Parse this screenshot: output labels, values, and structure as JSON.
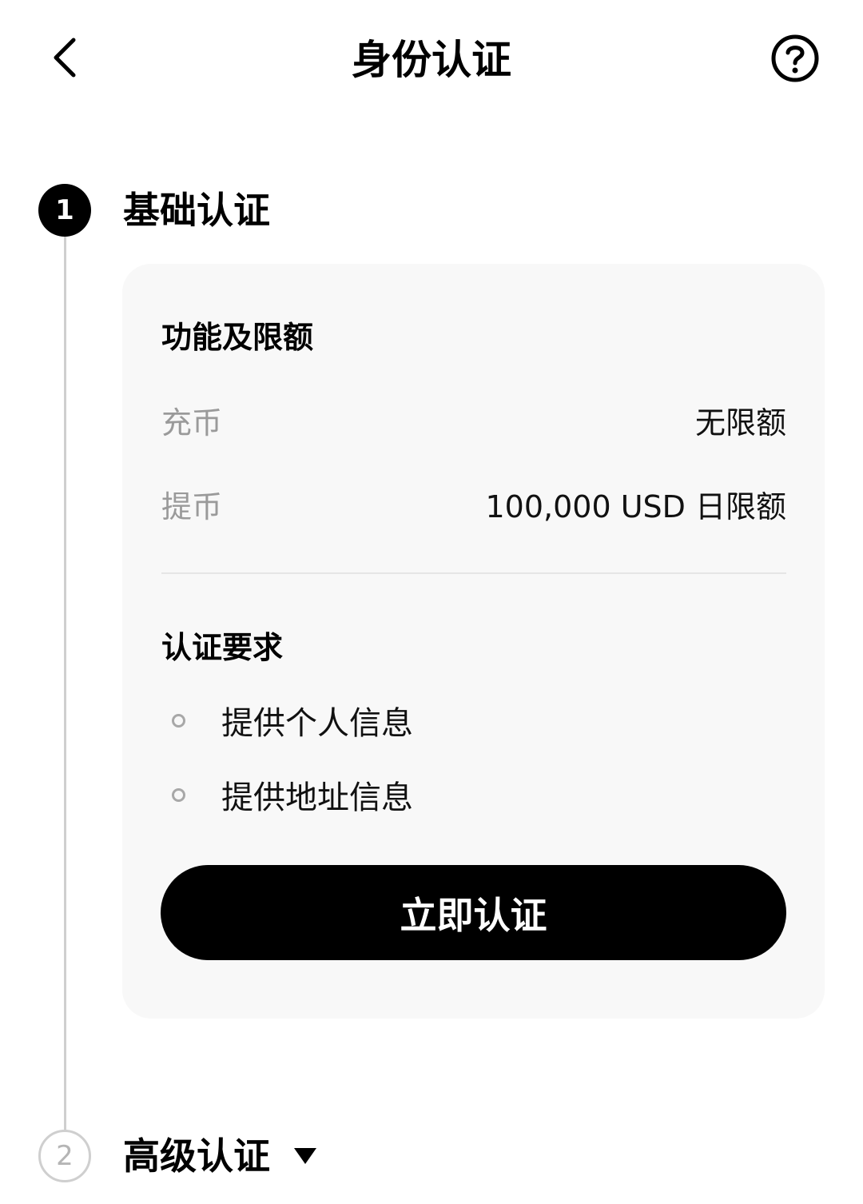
{
  "header": {
    "title": "身份认证",
    "back_icon": "chevron-left-icon",
    "help_icon": "question-circle-icon"
  },
  "steps": [
    {
      "number": "1",
      "title": "基础认证",
      "status": "active",
      "card": {
        "limits_title": "功能及限额",
        "limits": [
          {
            "label": "充币",
            "value": "无限额"
          },
          {
            "label": "提币",
            "value": "100,000 USD 日限额"
          }
        ],
        "requirements_title": "认证要求",
        "requirements": [
          "提供个人信息",
          "提供地址信息"
        ],
        "action_label": "立即认证"
      }
    },
    {
      "number": "2",
      "title": "高级认证",
      "status": "inactive",
      "expand_icon": "caret-down-icon"
    }
  ],
  "colors": {
    "primary": "#000000",
    "card_background": "#f8f8f8",
    "muted_text": "#9a9a9a",
    "timeline": "#cfcfcf"
  }
}
